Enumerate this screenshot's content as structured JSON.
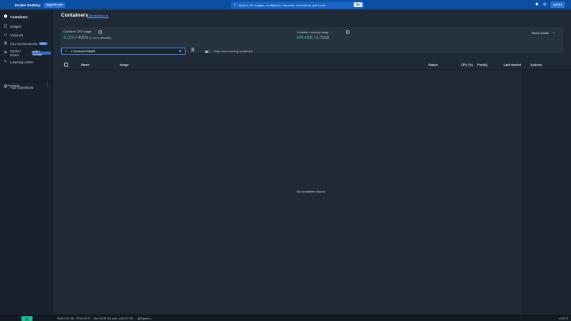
{
  "app": {
    "brand": "Docker Desktop",
    "upgrade_label": "Upgrade plan"
  },
  "search": {
    "placeholder": "Search for images, containers, volumes, extensions and more...",
    "shortcut": "⌘K"
  },
  "user": {
    "name": "seeb10"
  },
  "sidebar": {
    "items": [
      {
        "label": "Containers",
        "icon": "containers-icon",
        "active": true
      },
      {
        "label": "Images",
        "icon": "images-icon"
      },
      {
        "label": "Volumes",
        "icon": "volumes-icon"
      },
      {
        "label": "Dev Environments",
        "icon": "dev-environments-icon",
        "badge": "BETA"
      },
      {
        "label": "Docker Scout",
        "icon": "docker-scout-icon",
        "badge": "EARLY ACCESS"
      },
      {
        "label": "Learning center",
        "icon": "learning-center-icon"
      }
    ],
    "extensions_label": "Extensions",
    "add_extensions_label": "Add Extensions"
  },
  "page": {
    "title": "Containers",
    "feedback": "Give feedback ↯"
  },
  "stats": {
    "cpu_label": "Container CPU usage",
    "cpu_value": "3.15%",
    "cpu_total": "/ 400%",
    "cpu_sub": "(4 cores allocated)",
    "mem_label": "Container memory usage",
    "mem_value": "944.4MB",
    "mem_total": "/ 3.75GB",
    "show_charts": "Show charts"
  },
  "filter": {
    "value": "e7fe06ebb63f885f",
    "toggle_label": "Only show running containers"
  },
  "table": {
    "columns": [
      "Name",
      "Image",
      "Status",
      "CPU (%)",
      "Port(s)",
      "Last started",
      "Actions"
    ],
    "empty_message": "No containers found"
  },
  "footer": {
    "ram": "RAM 2.54 GB",
    "cpu": "CPU 6.51%",
    "disk": "Disk 34.59 GB avail. of 62.67 GB",
    "signed_in": "Signed in",
    "version": "v4.22.0"
  },
  "colors": {
    "topbar": "#0b4fa3",
    "accent": "#3d8bf0",
    "stat_green": "#3fc0a3",
    "sidebar": "#18212c",
    "main": "#1f2a36"
  }
}
